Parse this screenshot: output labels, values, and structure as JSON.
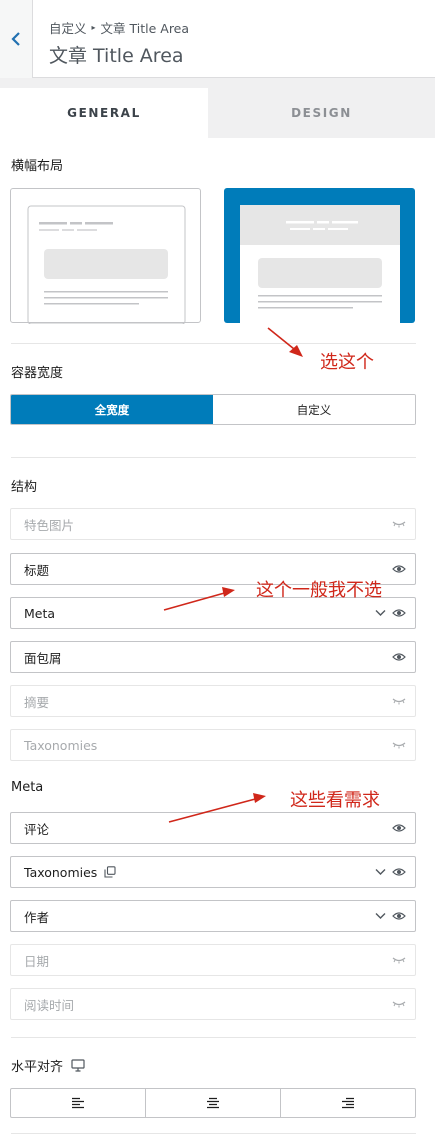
{
  "header": {
    "crumb_root": "自定义",
    "crumb_current": "文章 Title Area",
    "title": "文章 Title Area"
  },
  "tabs": [
    {
      "label": "GENERAL",
      "active": true
    },
    {
      "label": "DESIGN",
      "active": false
    }
  ],
  "layout": {
    "label": "横幅布局",
    "options": [
      {
        "name": "normal",
        "selected": false
      },
      {
        "name": "fullwidth-banner",
        "selected": true
      }
    ]
  },
  "container_width": {
    "label": "容器宽度",
    "options": [
      {
        "label": "全宽度",
        "active": true
      },
      {
        "label": "自定义",
        "active": false
      }
    ]
  },
  "structure": {
    "label": "结构",
    "items": [
      {
        "label": "特色图片",
        "visible": false,
        "expandable": false
      },
      {
        "label": "标题",
        "visible": true,
        "expandable": false
      },
      {
        "label": "Meta",
        "visible": true,
        "expandable": true
      },
      {
        "label": "面包屑",
        "visible": true,
        "expandable": false
      },
      {
        "label": "摘要",
        "visible": false,
        "expandable": false
      },
      {
        "label": "Taxonomies",
        "visible": false,
        "expandable": false
      }
    ]
  },
  "meta": {
    "label": "Meta",
    "items": [
      {
        "label": "评论",
        "visible": true,
        "expandable": false
      },
      {
        "label": "Taxonomies",
        "visible": true,
        "expandable": true,
        "copy_icon": true
      },
      {
        "label": "作者",
        "visible": true,
        "expandable": true
      },
      {
        "label": "日期",
        "visible": false,
        "expandable": false
      },
      {
        "label": "阅读时间",
        "visible": false,
        "expandable": false
      }
    ]
  },
  "alignment": {
    "label": "水平对齐",
    "device_icon": "desktop-icon",
    "options": [
      "align-left-icon",
      "align-center-icon",
      "align-right-icon"
    ]
  },
  "annotations": {
    "choose_this": "选这个",
    "usually_skip": "这个一般我不选",
    "as_needed": "这些看需求"
  },
  "colors": {
    "accent": "#007cba",
    "annotation": "#d0271a"
  }
}
